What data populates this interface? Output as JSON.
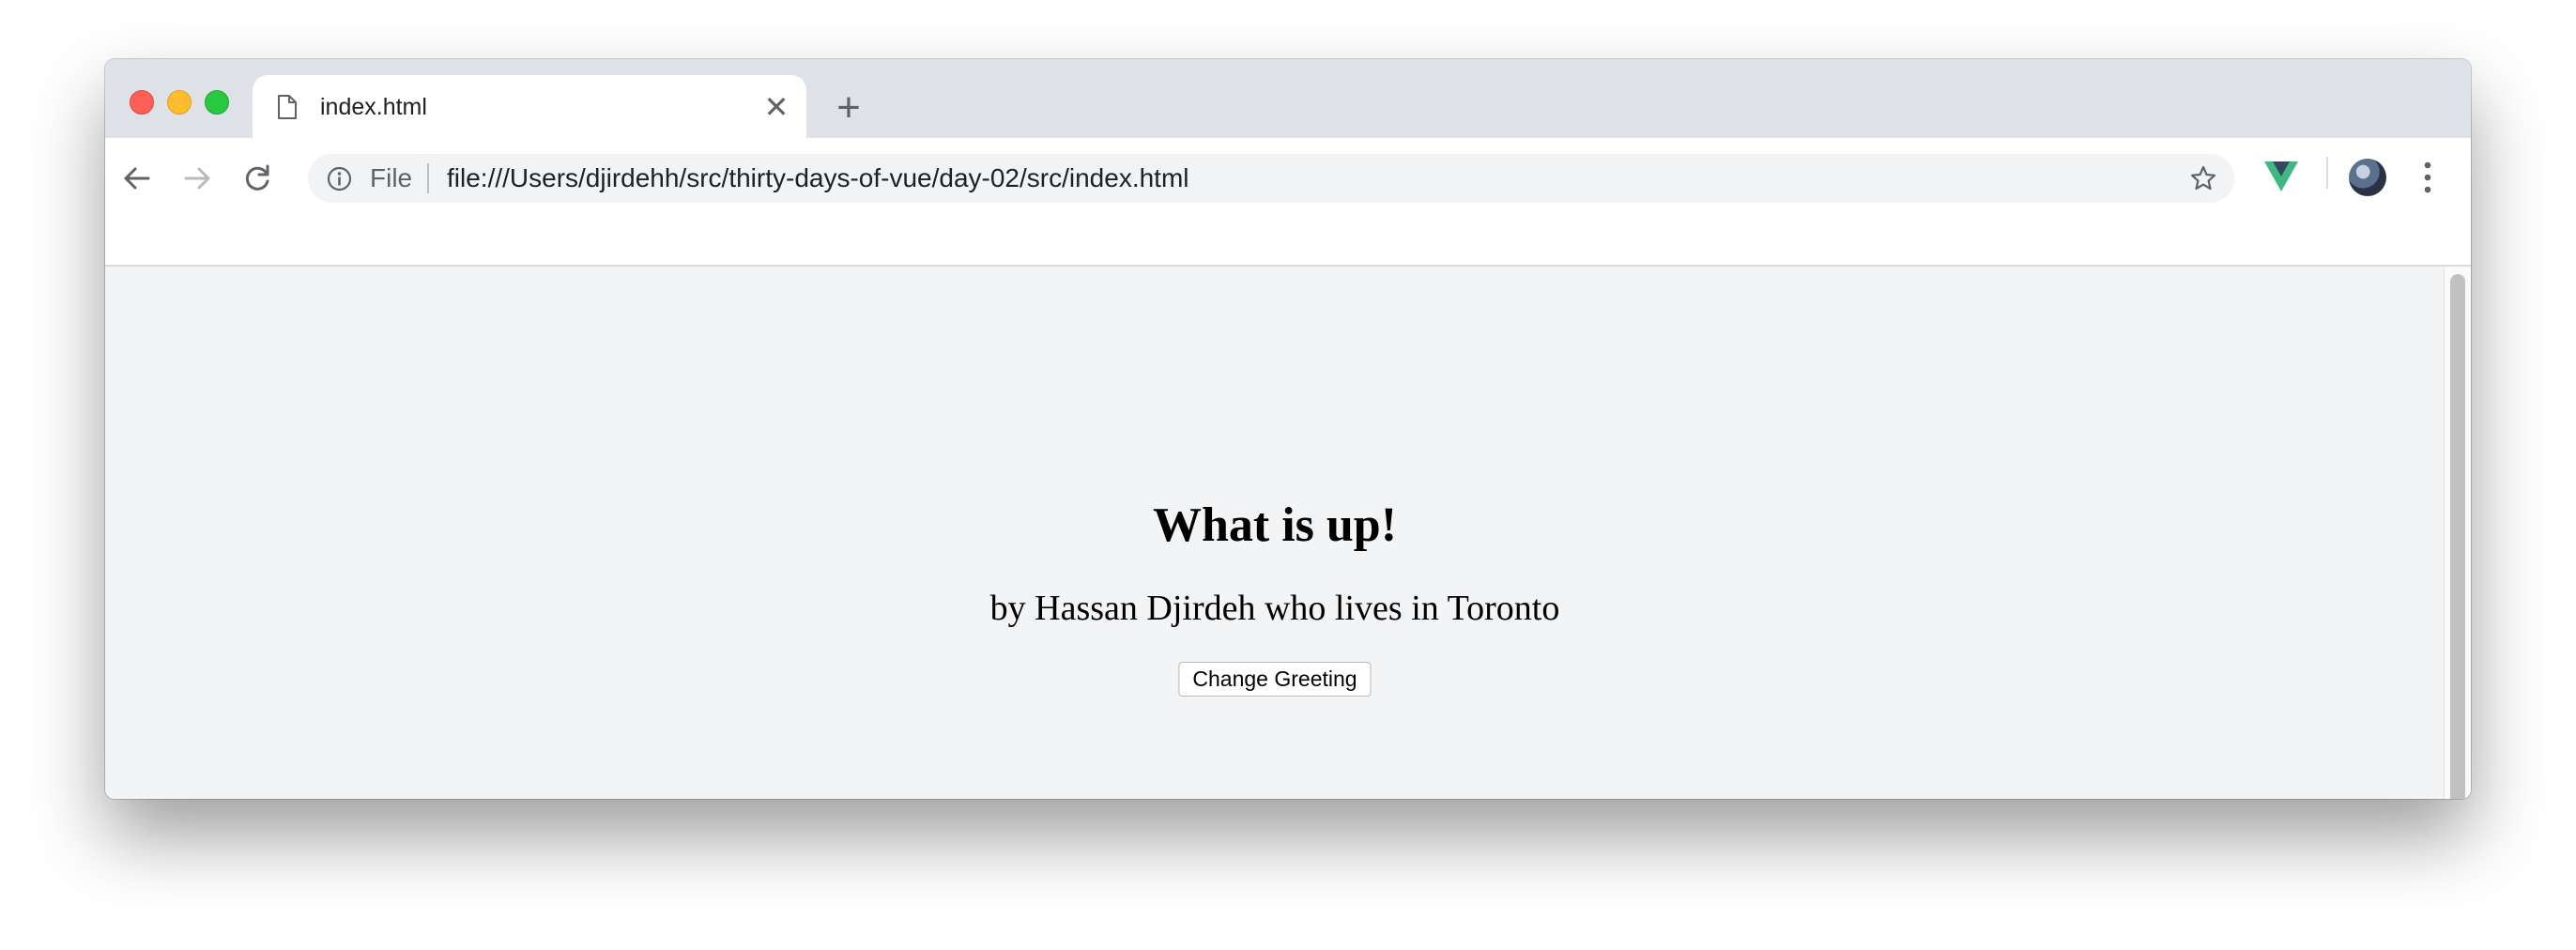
{
  "browser": {
    "tab": {
      "title": "index.html",
      "close_glyph": "✕",
      "icon": "file-icon"
    },
    "new_tab_glyph": "+",
    "omnibox": {
      "scheme_label": "File",
      "url": "file:///Users/djirdehh/src/thirty-days-of-vue/day-02/src/index.html"
    },
    "toolbar_icons": [
      "back-arrow-icon",
      "forward-arrow-icon",
      "reload-icon",
      "info-icon",
      "star-icon",
      "vue-devtools-icon",
      "avatar",
      "more-menu-icon"
    ],
    "colors": {
      "tabstrip": "#dee1e6",
      "close": "#fe5f57",
      "minimize": "#febc2e",
      "maximize": "#28c840",
      "vue_green": "#41b883",
      "vue_dark": "#34495e"
    }
  },
  "page": {
    "heading": "What is up!",
    "subtitle": "by Hassan Djirdeh who lives in Toronto",
    "button_label": "Change Greeting",
    "background": "#f3f4f6"
  }
}
